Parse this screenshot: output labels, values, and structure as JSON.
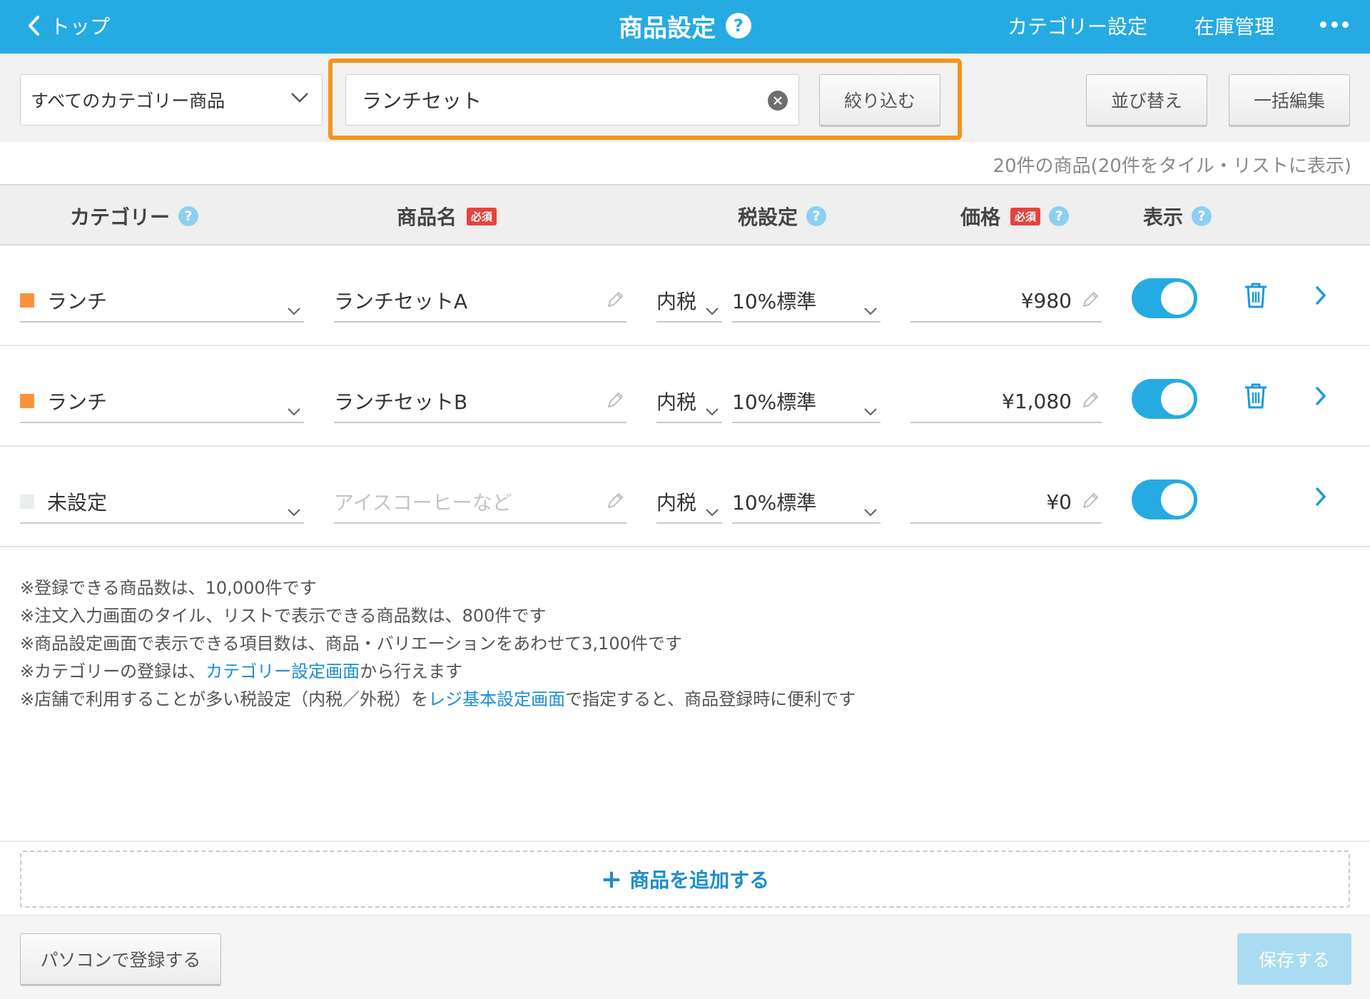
{
  "header": {
    "back_label": "トップ",
    "title": "商品設定",
    "help_mark": "?",
    "category_link": "カテゴリー設定",
    "inventory_link": "在庫管理"
  },
  "filter": {
    "category_select": "すべてのカテゴリー商品",
    "search_value": "ランチセット",
    "filter_button": "絞り込む",
    "sort_button": "並び替え",
    "bulk_edit_button": "一括編集"
  },
  "summary": {
    "count_text": "20件の商品(20件をタイル・リストに表示)"
  },
  "table": {
    "headers": {
      "category": "カテゴリー",
      "name": "商品名",
      "tax": "税設定",
      "price": "価格",
      "visible": "表示",
      "required_badge": "必須",
      "help_mark": "?"
    },
    "rows": [
      {
        "category": "ランチ",
        "category_color": "#f7943a",
        "name": "ランチセットA",
        "name_placeholder": "",
        "tax_type": "内税",
        "tax_rate": "10%標準",
        "price": "¥980",
        "visible": true,
        "deletable": true
      },
      {
        "category": "ランチ",
        "category_color": "#f7943a",
        "name": "ランチセットB",
        "name_placeholder": "",
        "tax_type": "内税",
        "tax_rate": "10%標準",
        "price": "¥1,080",
        "visible": true,
        "deletable": true
      },
      {
        "category": "未設定",
        "category_color": "#eaeeee",
        "name": "",
        "name_placeholder": "アイスコーヒーなど",
        "tax_type": "内税",
        "tax_rate": "10%標準",
        "price": "¥0",
        "visible": true,
        "deletable": false
      }
    ]
  },
  "notes": {
    "line1": "※登録できる商品数は、10,000件です",
    "line2": "※注文入力画面のタイル、リストで表示できる商品数は、800件です",
    "line3": "※商品設定画面で表示できる項目数は、商品・バリエーションをあわせて3,100件です",
    "line4_pre": "※カテゴリーの登録は、",
    "line4_link": "カテゴリー設定画面",
    "line4_post": "から行えます",
    "line5_pre": "※店舗で利用することが多い税設定（内税／外税）を",
    "line5_link": "レジ基本設定画面",
    "line5_post": "で指定すると、商品登録時に便利です"
  },
  "actions": {
    "add_product": "商品を追加する",
    "register_pc": "パソコンで登録する",
    "save": "保存する"
  },
  "colors": {
    "accent": "#25abe2",
    "highlight": "#f7941d",
    "required": "#e9413b",
    "link": "#1e8dd1"
  }
}
